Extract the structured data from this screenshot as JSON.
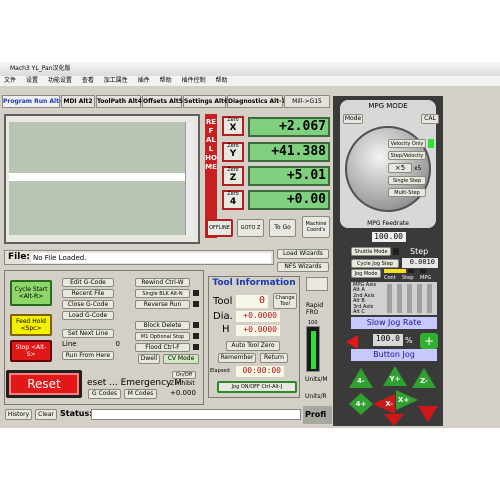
{
  "window": {
    "title": "Mach3 YL_Pan汉化版"
  },
  "menu": [
    "文件",
    "设置",
    "功能设置",
    "查看",
    "加工属性",
    "插件",
    "帮助",
    "插件控制",
    "帮助"
  ],
  "tabs": [
    "Program Run Alt-1",
    "MDI Alt2",
    "ToolPath Alt4",
    "Offsets Alt5",
    "Settings Alt6",
    "Diagnostics Alt-7",
    "Mill->G15"
  ],
  "axes": {
    "refall": "REF ALL HOME",
    "rows": [
      {
        "zero": "Zero",
        "letter": "X",
        "value": "+2.067"
      },
      {
        "zero": "Zero",
        "letter": "Y",
        "value": "+41.388"
      },
      {
        "zero": "Zero",
        "letter": "Z",
        "value": "+5.01"
      },
      {
        "zero": "Zero",
        "letter": "4",
        "value": "+0.00"
      }
    ],
    "buttons": [
      "OFFLINE",
      "GOTO Z",
      "To Go",
      "Machine Coord's"
    ]
  },
  "file": {
    "label": "File:",
    "value": "No File Loaded.",
    "load_wizards": "Load Wizards",
    "nfs_wizards": "NFS Wizards"
  },
  "left_buttons": {
    "cycle_start": "Cycle Start <Alt-R>",
    "feed_hold": "Feed Hold <Spc>",
    "stop": "Stop <Alt-S>",
    "reset": "Reset"
  },
  "file_buttons": [
    "Edit G-Code",
    "Recent File",
    "Close G-Code",
    "Load G-Code",
    "Set Next Line",
    "Run From Here"
  ],
  "line": {
    "label": "Line",
    "value": "0"
  },
  "run_buttons": [
    "Rewind Ctrl-W",
    "Single BLK Alt-N",
    "Reverse Run",
    "Block Delete",
    "M1 Optional Stop",
    "Flood Ctrl-F",
    "Dwell",
    "CV Mode"
  ],
  "tool_info": {
    "title": "Tool Information",
    "tool_label": "Tool",
    "tool_value": "0",
    "change_label": "Change Tool",
    "dia_label": "Dia.",
    "dia_value": "+0.0000",
    "h_label": "H",
    "h_value": "+0.0000",
    "auto_zero": "Auto Tool Zero",
    "remember": "Remember",
    "return": "Return",
    "elapsed_label": "Elapsed",
    "elapsed_value": "00:00:00",
    "jog_onoff": "Jog ON/OFF Ctrl-Alt-J"
  },
  "feed": {
    "rapid": "Rapid FRO",
    "value": "100",
    "units": "Units/M",
    "units2": "Units/R"
  },
  "bottom": {
    "reset_text": "eset ... Emergency M",
    "onoff": "On/Off",
    "inhibit": "Z inhibit",
    "inhibit_value": "+0.000",
    "gcodes": "G Codes",
    "mcodes": "M Codes",
    "history": "History",
    "clear": "Clear",
    "status_label": "Status:",
    "profile": "Profi"
  },
  "mpg": {
    "title": "MPG MODE",
    "mode": "Mode",
    "cal": "CAL",
    "velocity": "Velocity Only",
    "step_velocity": "Step/Velocity",
    "x5": "×5",
    "x5_label": "x5",
    "single_step": "Single Step",
    "multi_step": "Multi-Step",
    "feedrate_label": "MPG Feedrate",
    "feedrate_value": "100.00",
    "shuttle_mode": "Shuttle Mode",
    "step_label": "Step",
    "cycle_jog": "Cycle Jog Step",
    "step_value": "0.0010",
    "jog_mode": "Jog Mode",
    "cont": "Cont",
    "step_col": "Step",
    "mpg_col": "MPG",
    "mpg_rows": [
      "MPG Axis Alt A",
      "2nd Axis Alt B",
      "3rd Axis Alt C"
    ],
    "slow_jog_value": "100.0",
    "pct": "%",
    "slow_jog": "Slow Jog Rate",
    "button_jog": "Button Jog",
    "jog_buttons": [
      "4-",
      "Y+",
      "Z-",
      "4+",
      "X-",
      "X+"
    ]
  },
  "colors": {
    "bg": "#d4d0c8",
    "dro": "#7fd07f",
    "red": "#e01818",
    "mpg": "#3a3a3a",
    "blue": "#1a3bb0"
  }
}
